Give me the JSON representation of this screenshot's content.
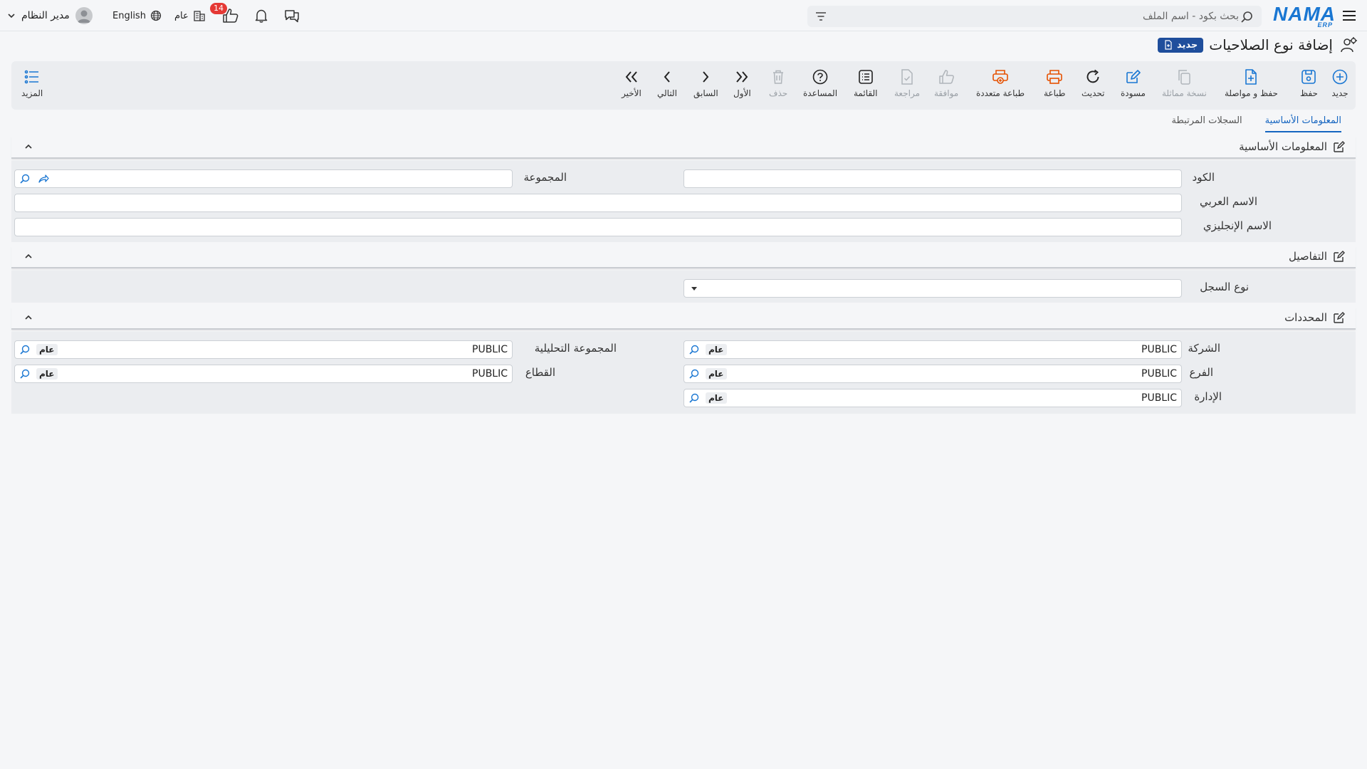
{
  "topbar": {
    "user_name": "مدير النظام",
    "language": "English",
    "year_label": "عام",
    "approvals_count": "14",
    "search_placeholder": "بحث بكود - اسم الملف",
    "logo_text": "NAMA",
    "logo_sub": "ERP"
  },
  "page": {
    "title": "إضافة نوع الصلاحيات",
    "mode_badge": "جديد"
  },
  "toolbar": {
    "new": "جديد",
    "save": "حفظ",
    "save_continue": "حفظ و مواصلة",
    "duplicate": "نسخة مماثلة",
    "draft": "مسودة",
    "refresh": "تحديث",
    "print": "طباعة",
    "multi_print": "طباعة متعددة",
    "approve": "موافقة",
    "review": "مراجعة",
    "list": "القائمة",
    "help": "المساعدة",
    "delete": "حذف",
    "first": "الأول",
    "previous": "السابق",
    "next": "التالي",
    "last": "الأخير",
    "more": "المزيد"
  },
  "tabs": [
    "المعلومات الأساسية",
    "السجلات المرتبطة"
  ],
  "sections": {
    "basic": {
      "title": "المعلومات الأساسية",
      "code_label": "الكود",
      "code_value": "",
      "group_label": "المجموعة",
      "group_value": "",
      "arabic_name_label": "الاسم العربي",
      "arabic_name_value": "",
      "english_name_label": "الاسم الإنجليزي",
      "english_name_value": ""
    },
    "details": {
      "title": "التفاصيل",
      "record_type_label": "نوع السجل",
      "record_type_value": ""
    },
    "determinants": {
      "title": "المحددات",
      "company_label": "الشركة",
      "company_value": "PUBLIC",
      "company_chip": "عام",
      "branch_label": "الفرع",
      "branch_value": "PUBLIC",
      "branch_chip": "عام",
      "department_label": "الإدارة",
      "department_value": "PUBLIC",
      "department_chip": "عام",
      "analytic_group_label": "المجموعة التحليلية",
      "analytic_group_value": "PUBLIC",
      "analytic_group_chip": "عام",
      "sector_label": "القطاع",
      "sector_value": "PUBLIC",
      "sector_chip": "عام"
    }
  },
  "colors": {
    "accent": "#1976d2",
    "badge_red": "#e53935",
    "print_orange": "#e65100",
    "new_badge_bg": "#1f4e9c"
  }
}
